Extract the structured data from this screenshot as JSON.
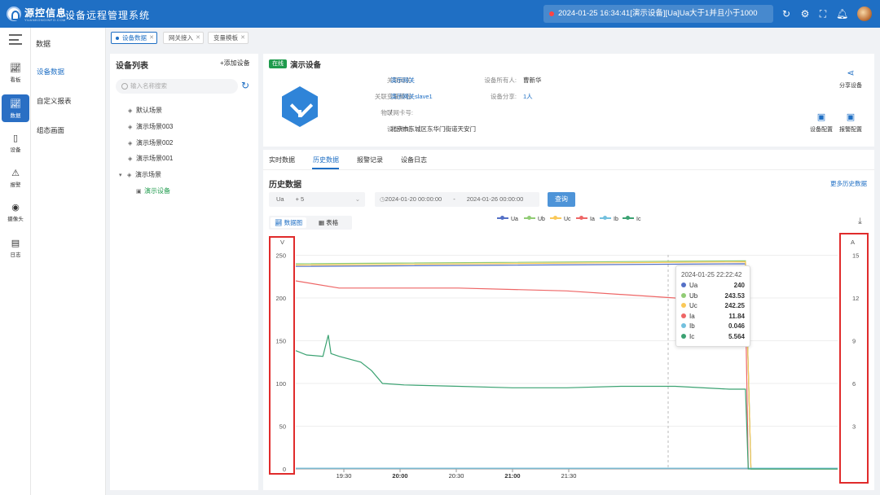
{
  "topbar": {
    "brand": "源控信息",
    "brand_sub": "YUANKONGINFO.COM",
    "app_title": "设备远程管理系统",
    "alarm_text": "2024-01-25 16:34:41[演示设备][Ua]Ua大于1并且小于1000"
  },
  "sidebar": {
    "items": [
      {
        "label": "看板",
        "icon": "chart-icon"
      },
      {
        "label": "数据",
        "icon": "chart-icon"
      },
      {
        "label": "设备",
        "icon": "device-icon"
      },
      {
        "label": "报警",
        "icon": "alarm-icon"
      },
      {
        "label": "摄像头",
        "icon": "camera-icon"
      },
      {
        "label": "日志",
        "icon": "log-icon"
      }
    ]
  },
  "subnav": {
    "title": "数据",
    "items": [
      "设备数据",
      "自定义报表",
      "组态画面"
    ]
  },
  "page_tabs": [
    "设备数据",
    "网关接入",
    "变量模板"
  ],
  "device_list": {
    "title": "设备列表",
    "add": "+添加设备",
    "search_placeholder": "输入名称搜索",
    "tree": [
      "默认场景",
      "演示场景003",
      "演示场景002",
      "演示场景001",
      "演示场景",
      "演示设备"
    ]
  },
  "device": {
    "status": "在线",
    "name": "演示设备",
    "fields": [
      {
        "label": "关联网关:",
        "value": "演示网关"
      },
      {
        "label": "关联变量模板:",
        "value": "演示网关slave1"
      },
      {
        "label": "物联网卡号:",
        "value": "/"
      },
      {
        "label": "设备地址:",
        "value": "北京市东城区东华门街道天安门"
      },
      {
        "label": "设备所有人:",
        "value": "曹新华"
      },
      {
        "label": "设备分享:",
        "value": "1人"
      }
    ],
    "actions": {
      "share": "分享设备",
      "config": "设备配置",
      "alarm_config": "报警配置"
    }
  },
  "main": {
    "tabs": [
      "实时数据",
      "历史数据",
      "报警记录",
      "设备日志"
    ],
    "history_title": "历史数据",
    "more": "更多历史数据",
    "filter": {
      "vars": "Ua",
      "plus": "+ 5",
      "start": "2024-01-20 00:00:00",
      "sep": "-",
      "end": "2024-01-26 00:00:00",
      "query": "查询"
    },
    "views": [
      "数据图",
      "表格"
    ]
  },
  "tooltip": {
    "time": "2024-01-25 22:22:42",
    "rows": [
      {
        "name": "Ua",
        "value": "240",
        "color": "#5470c6"
      },
      {
        "name": "Ub",
        "value": "243.53",
        "color": "#91cc75"
      },
      {
        "name": "Uc",
        "value": "242.25",
        "color": "#fac858"
      },
      {
        "name": "Ia",
        "value": "11.84",
        "color": "#ee6666"
      },
      {
        "name": "Ib",
        "value": "0.046",
        "color": "#73c0de"
      },
      {
        "name": "Ic",
        "value": "5.564",
        "color": "#3ba272"
      }
    ]
  },
  "chart_data": {
    "type": "line",
    "left_axis": {
      "unit": "V",
      "ticks": [
        0,
        50,
        100,
        150,
        200,
        250
      ],
      "range": [
        0,
        260
      ]
    },
    "right_axis": {
      "unit": "A",
      "ticks": [
        3,
        6,
        9,
        12,
        15
      ],
      "range": [
        0,
        15.6
      ]
    },
    "x_ticks": [
      "19:30",
      "20:00",
      "20:30",
      "21:00",
      "21:30"
    ],
    "series": [
      {
        "name": "Ua",
        "axis": "left",
        "color": "#5470c6",
        "x": [
          0,
          0.83,
          0.84,
          1
        ],
        "y": [
          237,
          240,
          0,
          0
        ]
      },
      {
        "name": "Ub",
        "axis": "left",
        "color": "#91cc75",
        "x": [
          0,
          0.83,
          0.84,
          1
        ],
        "y": [
          240,
          243.5,
          0,
          0
        ]
      },
      {
        "name": "Uc",
        "axis": "left",
        "color": "#fac858",
        "x": [
          0,
          0.83,
          0.84,
          1
        ],
        "y": [
          238.5,
          242.3,
          0,
          0
        ]
      },
      {
        "name": "Ia",
        "axis": "right",
        "color": "#ee6666",
        "x": [
          0,
          0.08,
          0.3,
          0.5,
          0.7,
          0.83,
          0.835
        ],
        "y": [
          13.2,
          12.7,
          12.7,
          12.5,
          12.0,
          11.84,
          0
        ]
      },
      {
        "name": "Ib",
        "axis": "right",
        "color": "#73c0de",
        "x": [
          0,
          0.83,
          1
        ],
        "y": [
          0.05,
          0.05,
          0.05
        ]
      },
      {
        "name": "Ic",
        "axis": "right",
        "color": "#3ba272",
        "x": [
          0,
          0.02,
          0.05,
          0.06,
          0.065,
          0.08,
          0.12,
          0.14,
          0.16,
          0.2,
          0.3,
          0.4,
          0.5,
          0.6,
          0.7,
          0.8,
          0.82,
          0.83,
          0.835,
          1
        ],
        "y": [
          8.3,
          8.0,
          7.9,
          9.4,
          8.1,
          7.9,
          7.5,
          6.9,
          6.0,
          5.9,
          5.8,
          5.7,
          5.7,
          5.8,
          5.8,
          5.6,
          5.6,
          5.6,
          0,
          0
        ]
      }
    ]
  }
}
